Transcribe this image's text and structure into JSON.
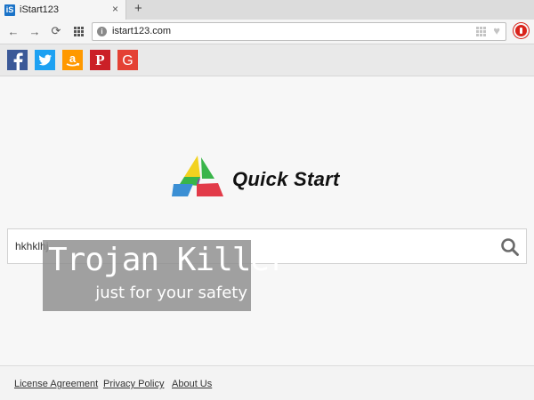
{
  "tab": {
    "title": "iStart123",
    "favicon_letter": "iS",
    "close_symbol": "×",
    "new_tab_symbol": "+"
  },
  "navbar": {
    "back_symbol": "←",
    "forward_symbol": "→",
    "reload_symbol": "⟳",
    "url": "istart123.com",
    "info_symbol": "i",
    "heart_symbol": "♥"
  },
  "bookmarks": [
    {
      "name": "facebook",
      "color": "#3b5998",
      "glyph": "f"
    },
    {
      "name": "twitter",
      "color": "#1da1f2",
      "glyph": "t"
    },
    {
      "name": "amazon",
      "color": "#f90",
      "glyph": "a"
    },
    {
      "name": "pinterest",
      "color": "#cb2027",
      "glyph": "P"
    },
    {
      "name": "google",
      "color": "#e44134",
      "glyph": "G"
    }
  ],
  "logo": {
    "text": "Quick Start"
  },
  "search": {
    "value": "hkhklhj",
    "icon": "search-icon"
  },
  "watermark": {
    "title": "Trojan Killer",
    "subtitle": "just for your safety"
  },
  "footer": {
    "license": "License Agreement",
    "privacy": "Privacy Policy",
    "about": "About Us"
  }
}
